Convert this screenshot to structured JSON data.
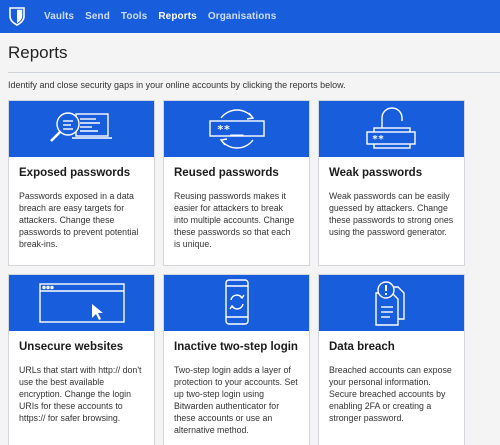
{
  "nav": {
    "items": [
      {
        "label": "Vaults",
        "active": false
      },
      {
        "label": "Send",
        "active": false
      },
      {
        "label": "Tools",
        "active": false
      },
      {
        "label": "Reports",
        "active": true
      },
      {
        "label": "Organisations",
        "active": false
      }
    ]
  },
  "page": {
    "title": "Reports",
    "intro": "Identify and close security gaps in your online accounts by clicking the reports below."
  },
  "reports": [
    {
      "title": "Exposed passwords",
      "description": "Passwords exposed in a data breach are easy targets for attackers. Change these passwords to prevent potential break-ins.",
      "icon": "exposed-passwords-icon"
    },
    {
      "title": "Reused passwords",
      "description": "Reusing passwords makes it easier for attackers to break into multiple accounts. Change these passwords so that each is unique.",
      "icon": "reused-passwords-icon"
    },
    {
      "title": "Weak passwords",
      "description": "Weak passwords can be easily guessed by attackers. Change these passwords to strong ones using the password generator.",
      "icon": "weak-passwords-icon"
    },
    {
      "title": "Unsecure websites",
      "description": "URLs that start with http:// don't use the best available encryption. Change the login URIs for these accounts to https:// for safer browsing.",
      "icon": "unsecure-websites-icon"
    },
    {
      "title": "Inactive two-step login",
      "description": "Two-step login adds a layer of protection to your accounts. Set up two-step login using Bitwarden authenticator for these accounts or use an alternative method.",
      "icon": "inactive-2fa-icon"
    },
    {
      "title": "Data breach",
      "description": "Breached accounts can expose your personal information. Secure breached accounts by enabling 2FA or creating a stronger password.",
      "icon": "data-breach-icon"
    }
  ],
  "colors": {
    "brand": "#175ddc",
    "background": "#f4f4f5"
  }
}
